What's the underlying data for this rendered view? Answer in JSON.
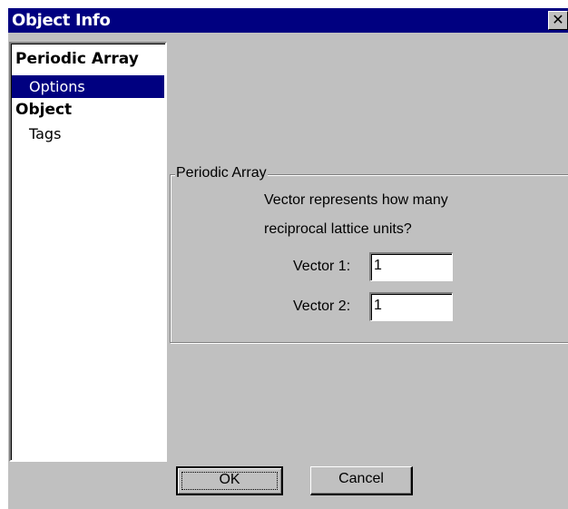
{
  "window": {
    "title": "Object Info",
    "close_icon": "close-icon",
    "close_glyph": "✕"
  },
  "tree": {
    "items": [
      {
        "label": "Periodic Array",
        "bold": true,
        "selected": false
      },
      {
        "label": "Options",
        "bold": false,
        "selected": true
      },
      {
        "label": "Object",
        "bold": true,
        "selected": false
      },
      {
        "label": "Tags",
        "bold": false,
        "selected": false
      }
    ]
  },
  "group": {
    "label": "Periodic Array",
    "description_line1": "Vector represents how many",
    "description_line2": "reciprocal lattice units?",
    "fields": [
      {
        "label": "Vector 1:",
        "value": "1"
      },
      {
        "label": "Vector 2:",
        "value": "1"
      }
    ]
  },
  "buttons": {
    "ok_label": "OK",
    "cancel_label": "Cancel"
  },
  "colors": {
    "title_bar": "#000080",
    "dialog_face": "#c0c0c0",
    "selection": "#000080"
  }
}
